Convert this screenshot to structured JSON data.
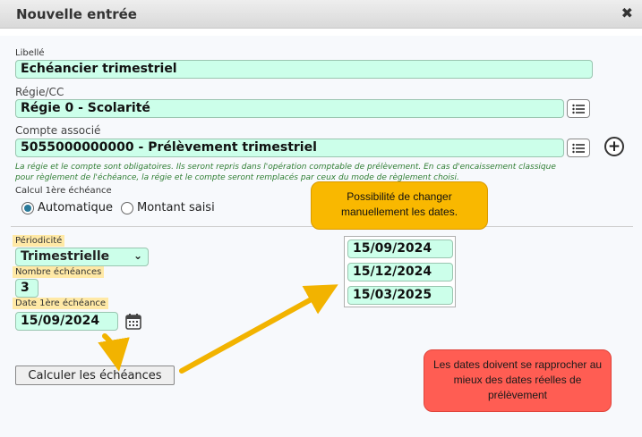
{
  "dialog": {
    "title": "Nouvelle entrée",
    "close_glyph": "✖"
  },
  "form": {
    "libelle_label": "Libellé",
    "libelle_value": "Echéancier trimestriel",
    "regie_label": "Régie/CC",
    "regie_value": "Régie 0 - Scolarité",
    "compte_label": "Compte associé",
    "compte_value": "5055000000000 - Prélèvement trimestriel",
    "info_text": "La régie et le compte sont obligatoires. Ils seront repris dans l'opération comptable de prélèvement. En cas d'encaissement classique pour règlement de l'échéance, la régie et le compte seront remplacés par ceux du mode de règlement choisi.",
    "calcul_label": "Calcul 1ère échéance",
    "radio_auto": "Automatique",
    "radio_montant": "Montant saisi",
    "periodicite_label": "Périodicité",
    "periodicite_value": "Trimestrielle",
    "nb_echeances_label": "Nombre échéances",
    "nb_echeances_value": "3",
    "date_label": "Date 1ère échéance",
    "date_value": "15/09/2024",
    "calc_button": "Calculer les échéances"
  },
  "schedule_dates": [
    "15/09/2024",
    "15/12/2024",
    "15/03/2025"
  ],
  "callouts": {
    "orange": "Possibilité de changer manuellement les dates.",
    "red": "Les dates doivent se rapprocher au mieux des dates réelles de prélèvement"
  },
  "icons": {
    "list": "list-icon",
    "add": "plus-circle-icon",
    "calendar": "calendar-icon",
    "close": "close-icon"
  },
  "colors": {
    "field_bg": "#ccffea",
    "highlight": "#ffe9a6",
    "callout_orange": "#f9b800",
    "callout_red": "#ff5d53",
    "arrow": "#f2b300",
    "info_text": "#2e7d32"
  }
}
